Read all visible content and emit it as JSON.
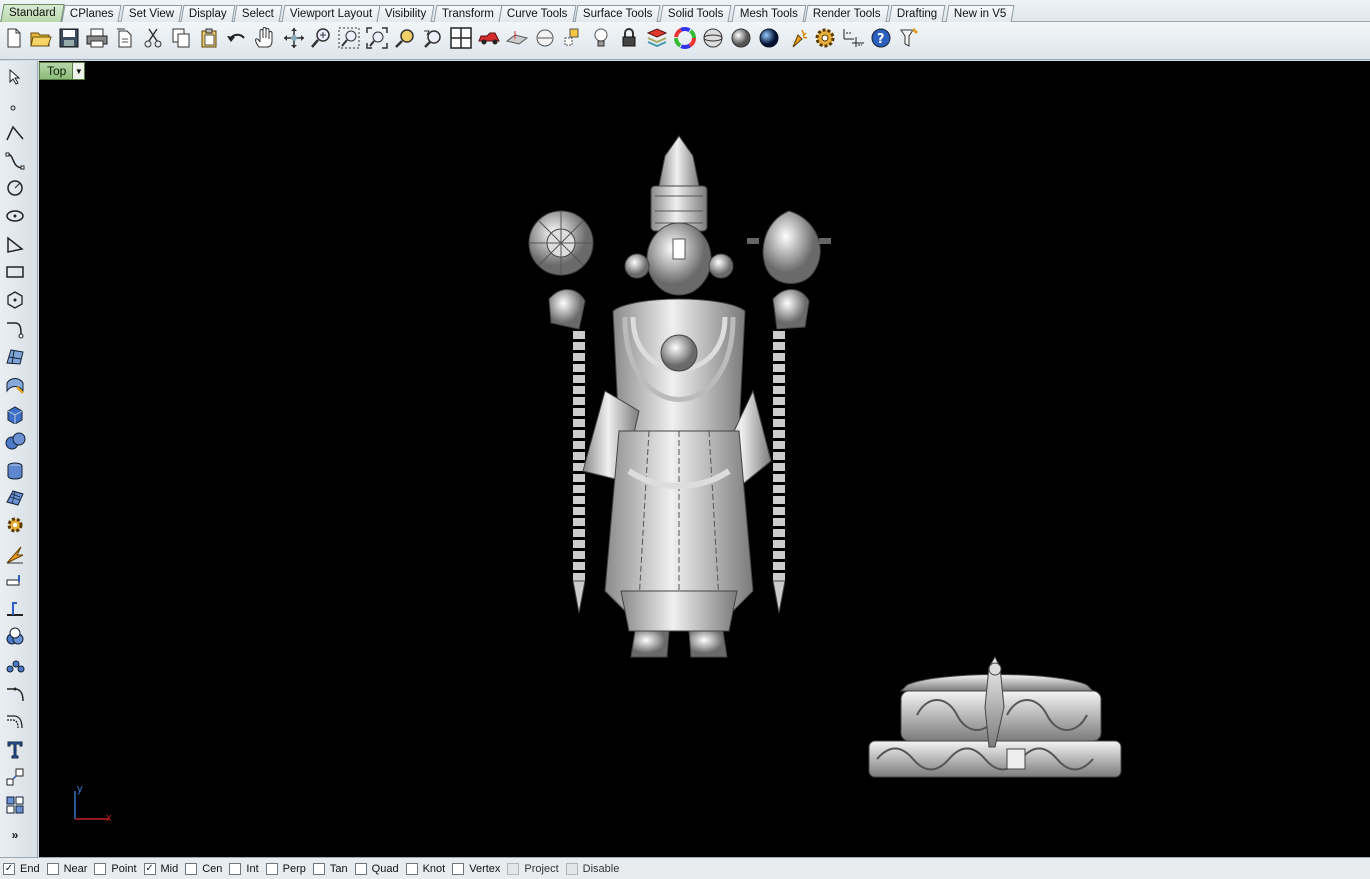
{
  "tabs": [
    {
      "label": "Standard",
      "active": true
    },
    {
      "label": "CPlanes"
    },
    {
      "label": "Set View"
    },
    {
      "label": "Display"
    },
    {
      "label": "Select"
    },
    {
      "label": "Viewport Layout"
    },
    {
      "label": "Visibility"
    },
    {
      "label": "Transform"
    },
    {
      "label": "Curve Tools"
    },
    {
      "label": "Surface Tools"
    },
    {
      "label": "Solid Tools"
    },
    {
      "label": "Mesh Tools"
    },
    {
      "label": "Render Tools"
    },
    {
      "label": "Drafting"
    },
    {
      "label": "New in V5"
    }
  ],
  "toolbar_icons": [
    "new-file-icon",
    "open-folder-icon",
    "save-icon",
    "print-icon",
    "import-icon",
    "cut-icon",
    "copy-icon",
    "paste-icon",
    "undo-icon",
    "pan-hand-icon",
    "rotate-view-icon",
    "zoom-icon",
    "zoom-window-icon",
    "zoom-extents-icon",
    "zoom-selected-icon",
    "undo-view-icon",
    "four-viewports-icon",
    "car-icon",
    "construction-plane-icon",
    "named-views-icon",
    "select-filter-icon",
    "light-bulb-icon",
    "lock-icon",
    "layer-icon",
    "color-wheel-icon",
    "wireframe-sphere-icon",
    "shaded-sphere-icon",
    "rendered-sphere-icon",
    "render-icon",
    "options-gear-icon",
    "dimension-icon",
    "help-icon",
    "tools-icon"
  ],
  "left_tools": [
    "select-arrow-icon",
    "point-icon",
    "polyline-icon",
    "curve-icon",
    "circle-icon",
    "ellipse-icon",
    "arc-icon",
    "rectangle-icon",
    "polygon-icon",
    "curve-from-object-icon",
    "surface-icon",
    "surface-tools-icon",
    "solid-box-icon",
    "solid-sphere-icon",
    "solid-tools-icon",
    "mesh-icon",
    "render-tools-icon",
    "transform-icon",
    "dimension-icon",
    "analyze-icon",
    "boolean-icon",
    "array-icon",
    "fillet-icon",
    "offset-icon",
    "text-icon",
    "scale-icon",
    "group-icon",
    "more-tools-icon"
  ],
  "viewport": {
    "label": "Top",
    "axis_y": "y",
    "axis_x": "x"
  },
  "osnaps": [
    {
      "label": "End",
      "checked": true
    },
    {
      "label": "Near",
      "checked": false
    },
    {
      "label": "Point",
      "checked": false
    },
    {
      "label": "Mid",
      "checked": true
    },
    {
      "label": "Cen",
      "checked": false
    },
    {
      "label": "Int",
      "checked": false
    },
    {
      "label": "Perp",
      "checked": false
    },
    {
      "label": "Tan",
      "checked": false
    },
    {
      "label": "Quad",
      "checked": false
    },
    {
      "label": "Knot",
      "checked": false
    },
    {
      "label": "Vertex",
      "checked": false
    },
    {
      "label": "Project",
      "checked": false,
      "disabled": true
    },
    {
      "label": "Disable",
      "checked": false,
      "disabled": true
    }
  ],
  "colors": {
    "active_tab": "#b9d7ad",
    "viewport_bg": "#000000",
    "model": "#d6d6d6",
    "axis_x": "#c02020",
    "axis_y": "#3a74c9"
  }
}
